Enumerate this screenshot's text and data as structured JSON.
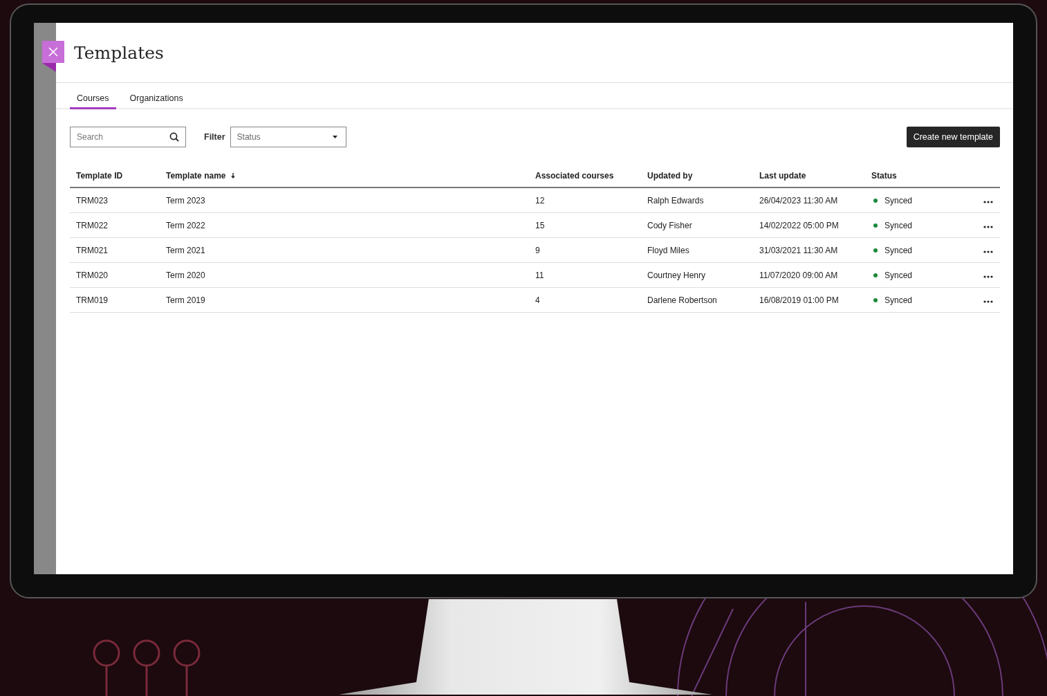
{
  "page": {
    "title": "Templates"
  },
  "tabs": [
    {
      "label": "Courses",
      "selected": true
    },
    {
      "label": "Organizations",
      "selected": false
    }
  ],
  "toolbar": {
    "search": {
      "placeholder": "Search"
    },
    "filter": {
      "label": "Filter",
      "placeholder": "Status"
    },
    "create_button": "Create new template"
  },
  "table": {
    "columns": [
      {
        "label": "Template ID",
        "sorted": false
      },
      {
        "label": "Template name",
        "sorted": true
      },
      {
        "label": "Associated courses",
        "sorted": false
      },
      {
        "label": "Updated by",
        "sorted": false
      },
      {
        "label": "Last update",
        "sorted": false
      },
      {
        "label": "Status",
        "sorted": false
      }
    ],
    "rows": [
      {
        "id": "TRM023",
        "name": "Term 2023",
        "courses": "12",
        "updated_by": "Ralph Edwards",
        "last_update": "26/04/2023 11:30 AM",
        "status": "Synced",
        "color": "#1a8a3a"
      },
      {
        "id": "TRM022",
        "name": "Term 2022",
        "courses": "15",
        "updated_by": "Cody Fisher",
        "last_update": "14/02/2022 05:00 PM",
        "status": "Synced",
        "color": "#1a8a3a"
      },
      {
        "id": "TRM021",
        "name": "Term 2021",
        "courses": "9",
        "updated_by": "Floyd Miles",
        "last_update": "31/03/2021 11:30 AM",
        "status": "Synced",
        "color": "#1a8a3a"
      },
      {
        "id": "TRM020",
        "name": "Term 2020",
        "courses": "11",
        "updated_by": "Courtney Henry",
        "last_update": "11/07/2020 09:00 AM",
        "status": "Synced",
        "color": "#1a8a3a"
      },
      {
        "id": "TRM019",
        "name": "Term 2019",
        "courses": "4",
        "updated_by": "Darlene Robertson",
        "last_update": "16/08/2019 01:00 PM",
        "status": "Synced",
        "color": "#1a8a3a"
      }
    ]
  }
}
